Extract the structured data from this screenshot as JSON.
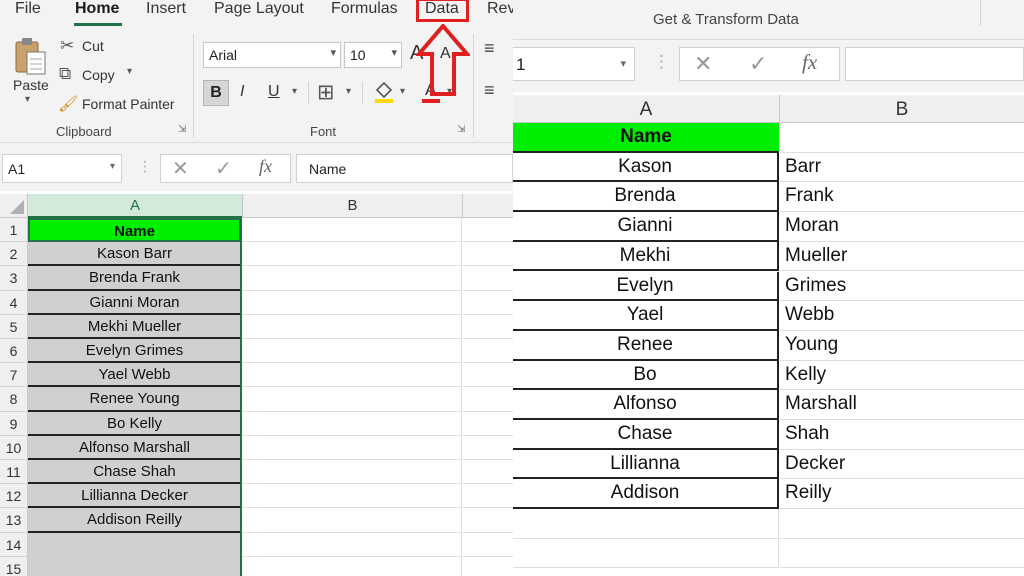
{
  "ribbon": {
    "tabs": {
      "file": "File",
      "home": "Home",
      "insert": "Insert",
      "page_layout": "Page Layout",
      "formulas": "Formulas",
      "data": "Data",
      "review": "Rev"
    },
    "clipboard": {
      "paste": "Paste",
      "cut": "Cut",
      "copy": "Copy",
      "format_painter": "Format Painter",
      "group_label": "Clipboard"
    },
    "font": {
      "name": "Arial",
      "size": "10",
      "bold": "B",
      "italic": "I",
      "underline": "U",
      "group_label": "Font"
    },
    "get_transform_label": "Get & Transform Data"
  },
  "formula_bar": {
    "name_box": "A1",
    "content": "Name",
    "right_name_box": "1"
  },
  "left_sheet": {
    "col_a": "A",
    "col_b": "B",
    "rows": [
      "1",
      "2",
      "3",
      "4",
      "5",
      "6",
      "7",
      "8",
      "9",
      "10",
      "11",
      "12",
      "13",
      "14",
      "15"
    ],
    "cells": [
      "Name",
      "Kason Barr",
      "Brenda Frank",
      "Gianni Moran",
      "Mekhi Mueller",
      "Evelyn Grimes",
      "Yael Webb",
      "Renee Young",
      "Bo Kelly",
      "Alfonso Marshall",
      "Chase Shah",
      "Lillianna Decker",
      "Addison Reilly",
      "",
      ""
    ]
  },
  "right_sheet": {
    "col_a": "A",
    "col_b": "B",
    "header": "Name",
    "first_names": [
      "Kason",
      "Brenda",
      "Gianni",
      "Mekhi",
      "Evelyn",
      "Yael",
      "Renee",
      "Bo",
      "Alfonso",
      "Chase",
      "Lillianna",
      "Addison"
    ],
    "last_names": [
      "Barr",
      "Frank",
      "Moran",
      "Mueller",
      "Grimes",
      "Webb",
      "Young",
      "Kelly",
      "Marshall",
      "Shah",
      "Decker",
      "Reilly"
    ]
  },
  "colors": {
    "header_fill": "#00ee00",
    "selection_fill": "#d0d0d0",
    "excel_green": "#217346",
    "callout_red": "#e02020"
  }
}
